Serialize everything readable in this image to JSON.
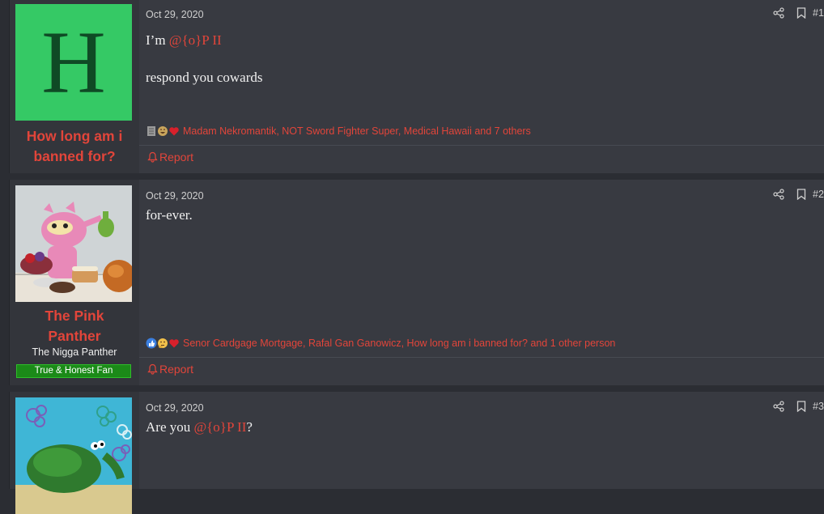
{
  "posts": [
    {
      "user": {
        "avatar_letter": "H",
        "avatar_color": "#35c965",
        "name": "How long am i banned for?",
        "name_lines": [
          "How long am i",
          "banned for?"
        ]
      },
      "date": "Oct 29, 2020",
      "number": "#1",
      "message": {
        "line1_prefix": "I’m ",
        "line1_mention": "@{o}P II",
        "line2": "respond you cowards"
      },
      "reactions": {
        "icons": [
          "receipt-icon",
          "laugh-icon",
          "heart-icon"
        ],
        "text": "Madam Nekromantik, NOT Sword Fighter Super, Medical Hawaii and 7 others"
      },
      "report_label": "Report"
    },
    {
      "user": {
        "name_lines": [
          "The Pink",
          "Panther"
        ],
        "title": "The Nigga Panther",
        "banner": "True & Honest Fan"
      },
      "date": "Oct 29, 2020",
      "number": "#2",
      "message": {
        "text": "for-ever."
      },
      "reactions": {
        "icons": [
          "thumbs-up-icon",
          "thinking-icon",
          "heart-icon"
        ],
        "text": "Senor Cardgage Mortgage, Rafal Gan Ganowicz, How long am i banned for? and 1 other person"
      },
      "report_label": "Report"
    },
    {
      "date": "Oct 29, 2020",
      "number": "#3",
      "message": {
        "prefix": "Are you ",
        "mention": "@{o}P II",
        "suffix": "?"
      }
    }
  ],
  "colors": {
    "background": "#2b2d33",
    "post_bg": "#383a41",
    "user_cell_bg": "#33353b",
    "accent_red": "#e2453a",
    "banner_green": "#1b8a18"
  }
}
